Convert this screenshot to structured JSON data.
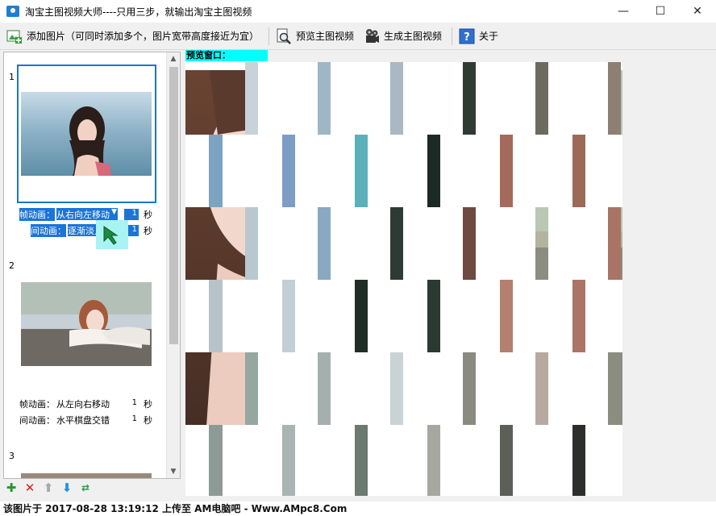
{
  "window": {
    "title": "淘宝主图视频大师----只用三步，就输出淘宝主图视频",
    "minimize": "—",
    "maximize": "☐",
    "close": "✕"
  },
  "toolbar": {
    "add_images": "添加图片（可同时添加多个，图片宽带高度接近为宜）",
    "preview": "预览主图视频",
    "generate": "生成主图视频",
    "about": "关于"
  },
  "image_list": {
    "items": [
      {
        "number": "1",
        "frame_anim_label": "帧动画：",
        "frame_anim_value": "从右向左移动",
        "frame_sec": "1",
        "trans_anim_label": "间动画：",
        "trans_anim_value": "逐渐淡入",
        "trans_sec": "1",
        "sec_unit": "秒",
        "selected": true
      },
      {
        "number": "2",
        "frame_anim_label": "帧动画：",
        "frame_anim_value": "从左向右移动",
        "frame_sec": "1",
        "trans_anim_label": "间动画：",
        "trans_anim_value": "水平棋盘交错",
        "trans_sec": "1",
        "sec_unit": "秒",
        "selected": false
      },
      {
        "number": "3"
      }
    ]
  },
  "preview": {
    "label": "预览窗口："
  },
  "statusbar": {
    "text": "该图片于 2017-08-28 13:19:12 上传至 AM电脑吧 - Www.AMpc8.Com"
  },
  "colors": {
    "accent": "#1b74d6",
    "preview_label_bg": "#00ffff"
  }
}
